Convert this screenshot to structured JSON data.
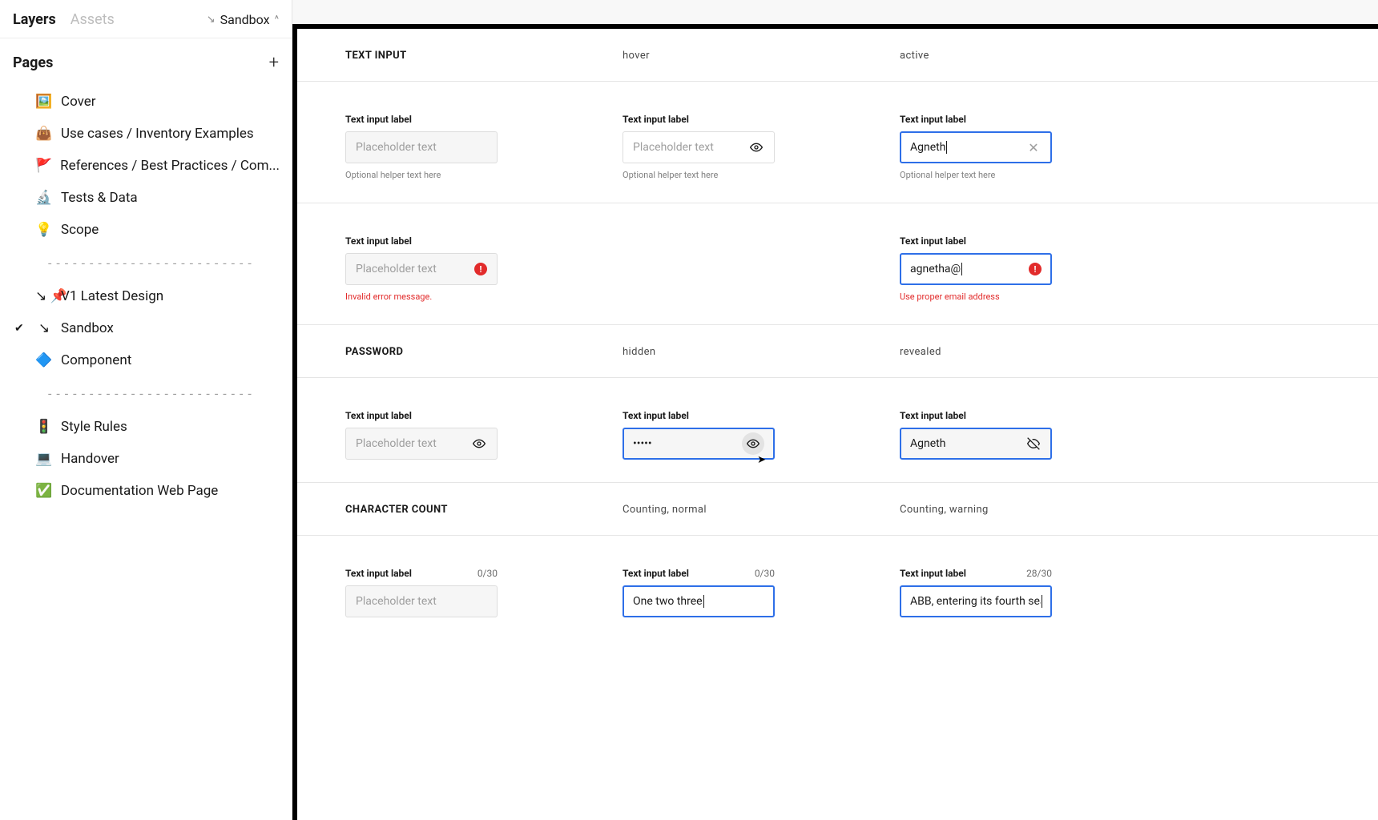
{
  "sidebar": {
    "tabs": {
      "layers": "Layers",
      "assets": "Assets"
    },
    "crumb": {
      "arrow": "↘",
      "label": "Sandbox",
      "caret": "^"
    },
    "pages_title": "Pages",
    "items": [
      {
        "emoji": "🖼️",
        "label": "Cover"
      },
      {
        "emoji": "👜",
        "label": "Use cases / Inventory Examples"
      },
      {
        "emoji": "🚩",
        "label": "References  / Best Practices / Com..."
      },
      {
        "emoji": "🔬",
        "label": "Tests & Data"
      },
      {
        "emoji": "💡",
        "label": "Scope"
      },
      {
        "divider": "- - - - - - - - - - - - - - - - - - - - - - - - -"
      },
      {
        "prefix": "↘",
        "emoji": "📌",
        "label": "V1  Latest Design"
      },
      {
        "prefix": "↘",
        "label": "Sandbox",
        "selected": true
      },
      {
        "emoji": "🔷",
        "label": "Component"
      },
      {
        "divider": "- - - - - - - - - - - - - - - - - - - - - - - - -"
      },
      {
        "emoji": "🚦",
        "label": "Style Rules"
      },
      {
        "emoji": "💻",
        "label": "Handover"
      },
      {
        "emoji": "✅",
        "label": "Documentation Web Page"
      }
    ]
  },
  "canvas": {
    "sections": {
      "text_input": {
        "title": "TEXT INPUT",
        "hover": "hover",
        "active": "active",
        "row1": {
          "label": "Text input label",
          "placeholder": "Placeholder text",
          "active_value": "Agneth",
          "helper": "Optional helper text here"
        },
        "row2": {
          "label": "Text input label",
          "placeholder": "Placeholder text",
          "error_msg": "Invalid error message.",
          "active_value": "agnetha@",
          "active_helper": "Use proper email address"
        }
      },
      "password": {
        "title": "PASSWORD",
        "hidden": "hidden",
        "revealed": "revealed",
        "label": "Text input label",
        "placeholder": "Placeholder text",
        "dots": "•••••",
        "revealed_value": "Agneth"
      },
      "char_count": {
        "title": "CHARACTER COUNT",
        "normal": "Counting, normal",
        "warning": "Counting, warning",
        "label": "Text input label",
        "count_default": "0/30",
        "count_normal": "0/30",
        "count_warning": "28/30",
        "placeholder": "Placeholder text",
        "value_normal": "One two three",
        "value_warning": "ABB, entering its fourth season as title partner, is conti"
      }
    }
  }
}
